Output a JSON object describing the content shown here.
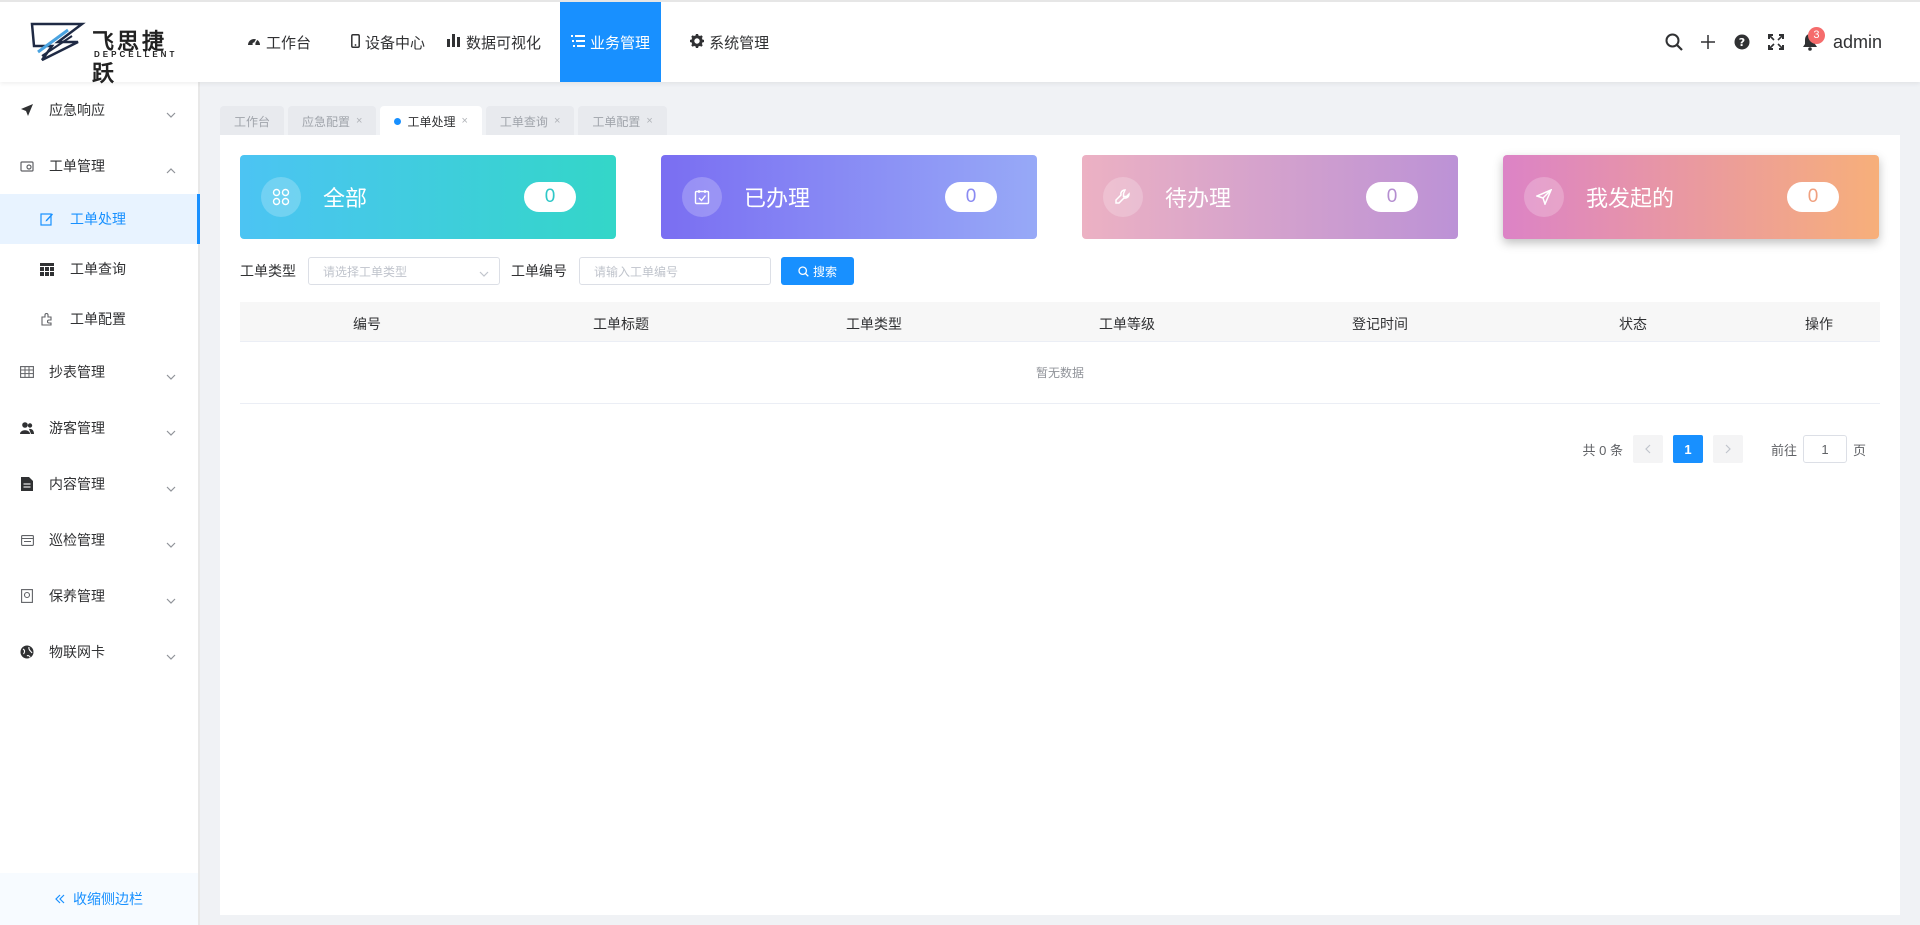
{
  "app": {
    "brand_name": "飞思捷跃",
    "brand_sub": "DEPCELLENT",
    "username": "admin",
    "notification_count": "3"
  },
  "topnav": [
    {
      "label": "工作台",
      "icon": "dashboard-icon"
    },
    {
      "label": "设备中心",
      "icon": "mobile-icon"
    },
    {
      "label": "数据可视化",
      "icon": "bar-chart-icon"
    },
    {
      "label": "业务管理",
      "icon": "list-icon",
      "active": true
    },
    {
      "label": "系统管理",
      "icon": "gear-icon"
    }
  ],
  "sidebar": {
    "items": [
      {
        "label": "应急响应",
        "icon": "send-icon"
      },
      {
        "label": "工单管理",
        "icon": "ticket-icon",
        "expanded": true,
        "children": [
          {
            "label": "工单处理",
            "icon": "edit-icon",
            "active": true
          },
          {
            "label": "工单查询",
            "icon": "grid-icon"
          },
          {
            "label": "工单配置",
            "icon": "puzzle-icon"
          }
        ]
      },
      {
        "label": "抄表管理",
        "icon": "table-icon"
      },
      {
        "label": "游客管理",
        "icon": "users-icon"
      },
      {
        "label": "内容管理",
        "icon": "document-icon"
      },
      {
        "label": "巡检管理",
        "icon": "calendar-icon"
      },
      {
        "label": "保养管理",
        "icon": "safe-icon"
      },
      {
        "label": "物联网卡",
        "icon": "globe-icon"
      }
    ],
    "collapse_label": "收缩侧边栏"
  },
  "tabs": [
    {
      "label": "工作台",
      "closable": false
    },
    {
      "label": "应急配置",
      "closable": true
    },
    {
      "label": "工单处理",
      "closable": true,
      "active": true
    },
    {
      "label": "工单查询",
      "closable": true
    },
    {
      "label": "工单配置",
      "closable": true
    }
  ],
  "cards": [
    {
      "label": "全部",
      "count": "0",
      "icon": "apps-icon"
    },
    {
      "label": "已办理",
      "count": "0",
      "icon": "check-calendar-icon"
    },
    {
      "label": "待办理",
      "count": "0",
      "icon": "wrench-icon"
    },
    {
      "label": "我发起的",
      "count": "0",
      "icon": "send-icon"
    }
  ],
  "filter": {
    "type_label": "工单类型",
    "type_placeholder": "请选择工单类型",
    "number_label": "工单编号",
    "number_placeholder": "请输入工单编号",
    "search_label": "搜索"
  },
  "table": {
    "columns": [
      "编号",
      "工单标题",
      "工单类型",
      "工单等级",
      "登记时间",
      "状态",
      "操作"
    ],
    "rows": [],
    "empty_text": "暂无数据"
  },
  "pagination": {
    "total_text": "共 0 条",
    "current_page": "1",
    "goto_prefix": "前往",
    "goto_value": "1",
    "goto_suffix": "页"
  },
  "colors": {
    "primary": "#1890ff",
    "badge": "#f56c6c"
  }
}
